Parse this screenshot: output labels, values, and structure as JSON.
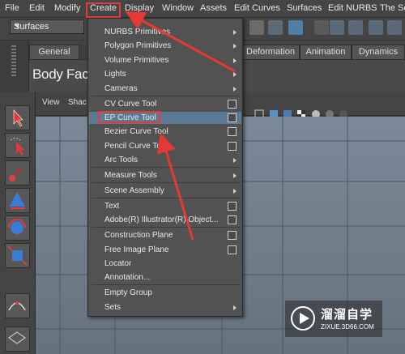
{
  "menubar": {
    "items": [
      "File",
      "Edit",
      "Modify",
      "Create",
      "Display",
      "Window",
      "Assets",
      "Edit Curves",
      "Surfaces",
      "Edit NURBS",
      "The Se"
    ]
  },
  "toolbar": {
    "mode_select": "Surfaces"
  },
  "shelf": {
    "tabs": [
      "General",
      "Deformation",
      "Animation",
      "Dynamics"
    ],
    "label": "Body Face"
  },
  "viewport": {
    "menus": [
      "View",
      "Shac"
    ]
  },
  "create_menu": {
    "items": [
      {
        "label": "NURBS Primitives",
        "submenu": true
      },
      {
        "label": "Polygon Primitives",
        "submenu": true
      },
      {
        "label": "Volume Primitives",
        "submenu": true
      },
      {
        "label": "Lights",
        "submenu": true
      },
      {
        "label": "Cameras",
        "submenu": true
      },
      {
        "label": "CV Curve Tool",
        "option_box": true
      },
      {
        "label": "EP Curve Tool",
        "option_box": true,
        "highlighted": true
      },
      {
        "label": "Bezier Curve Tool",
        "option_box": true
      },
      {
        "label": "Pencil Curve Tool",
        "option_box": true
      },
      {
        "label": "Arc Tools",
        "submenu": true
      },
      {
        "label": "Measure Tools",
        "submenu": true
      },
      {
        "label": "Scene Assembly",
        "submenu": true
      },
      {
        "label": "Text",
        "option_box": true
      },
      {
        "label": "Adobe(R) Illustrator(R) Object...",
        "option_box": true
      },
      {
        "label": "Construction Plane",
        "option_box": true
      },
      {
        "label": "Free Image Plane",
        "option_box": true
      },
      {
        "label": "Locator"
      },
      {
        "label": "Annotation..."
      },
      {
        "label": "Empty Group"
      },
      {
        "label": "Sets",
        "submenu": true
      }
    ]
  },
  "watermark": {
    "title": "溜溜自学",
    "subtitle": "ZIXUE.3D66.COM"
  },
  "colors": {
    "highlight": "#5c7996",
    "annotation_red": "#e53935",
    "viewport": "#7b8a99"
  }
}
